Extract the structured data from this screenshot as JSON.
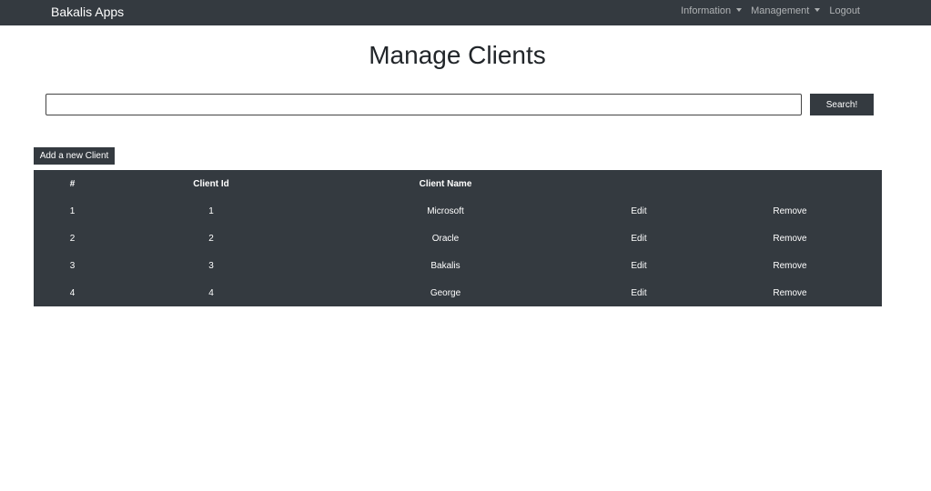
{
  "navbar": {
    "brand": "Bakalis Apps",
    "links": [
      {
        "label": "Information",
        "dropdown": true
      },
      {
        "label": "Management",
        "dropdown": true
      },
      {
        "label": "Logout",
        "dropdown": false
      }
    ]
  },
  "page": {
    "title": "Manage Clients"
  },
  "search": {
    "value": "",
    "button_label": "Search!"
  },
  "add_button_label": "Add a new Client",
  "table": {
    "headers": [
      "#",
      "Client Id",
      "Client Name",
      "",
      ""
    ],
    "rows": [
      {
        "num": "1",
        "id": "1",
        "name": "Microsoft",
        "edit": "Edit",
        "remove": "Remove"
      },
      {
        "num": "2",
        "id": "2",
        "name": "Oracle",
        "edit": "Edit",
        "remove": "Remove"
      },
      {
        "num": "3",
        "id": "3",
        "name": "Bakalis",
        "edit": "Edit",
        "remove": "Remove"
      },
      {
        "num": "4",
        "id": "4",
        "name": "George",
        "edit": "Edit",
        "remove": "Remove"
      }
    ]
  },
  "colors": {
    "navbar_bg": "#343a40",
    "table_bg": "#343a40",
    "button_bg": "#343a40"
  }
}
